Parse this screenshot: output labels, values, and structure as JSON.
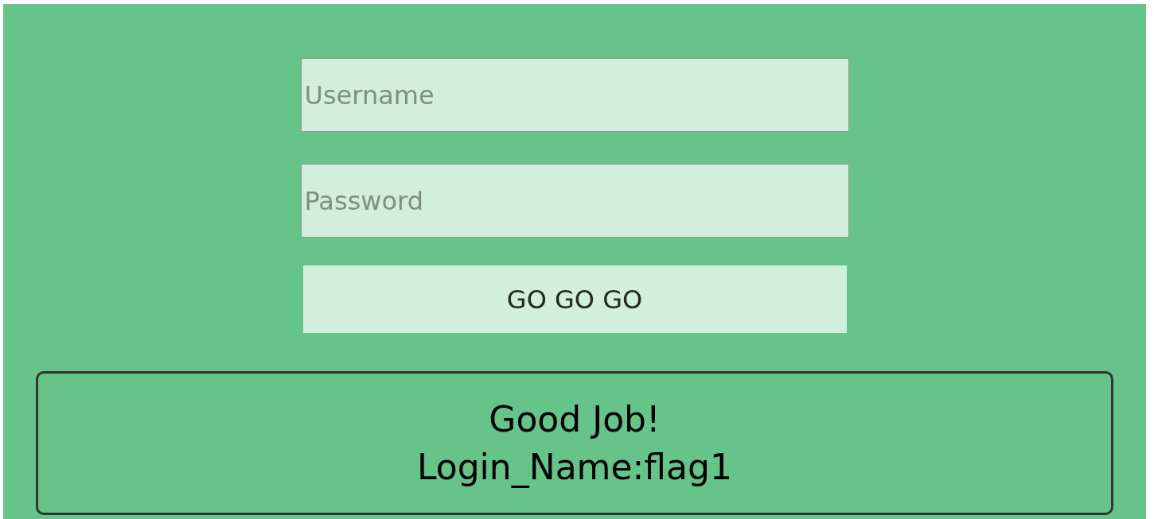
{
  "form": {
    "username": {
      "placeholder": "Username"
    },
    "password": {
      "placeholder": "Password"
    },
    "submit": "GO GO GO"
  },
  "result": {
    "lines": [
      "Good Job!",
      "Login_Name:flag1"
    ]
  }
}
